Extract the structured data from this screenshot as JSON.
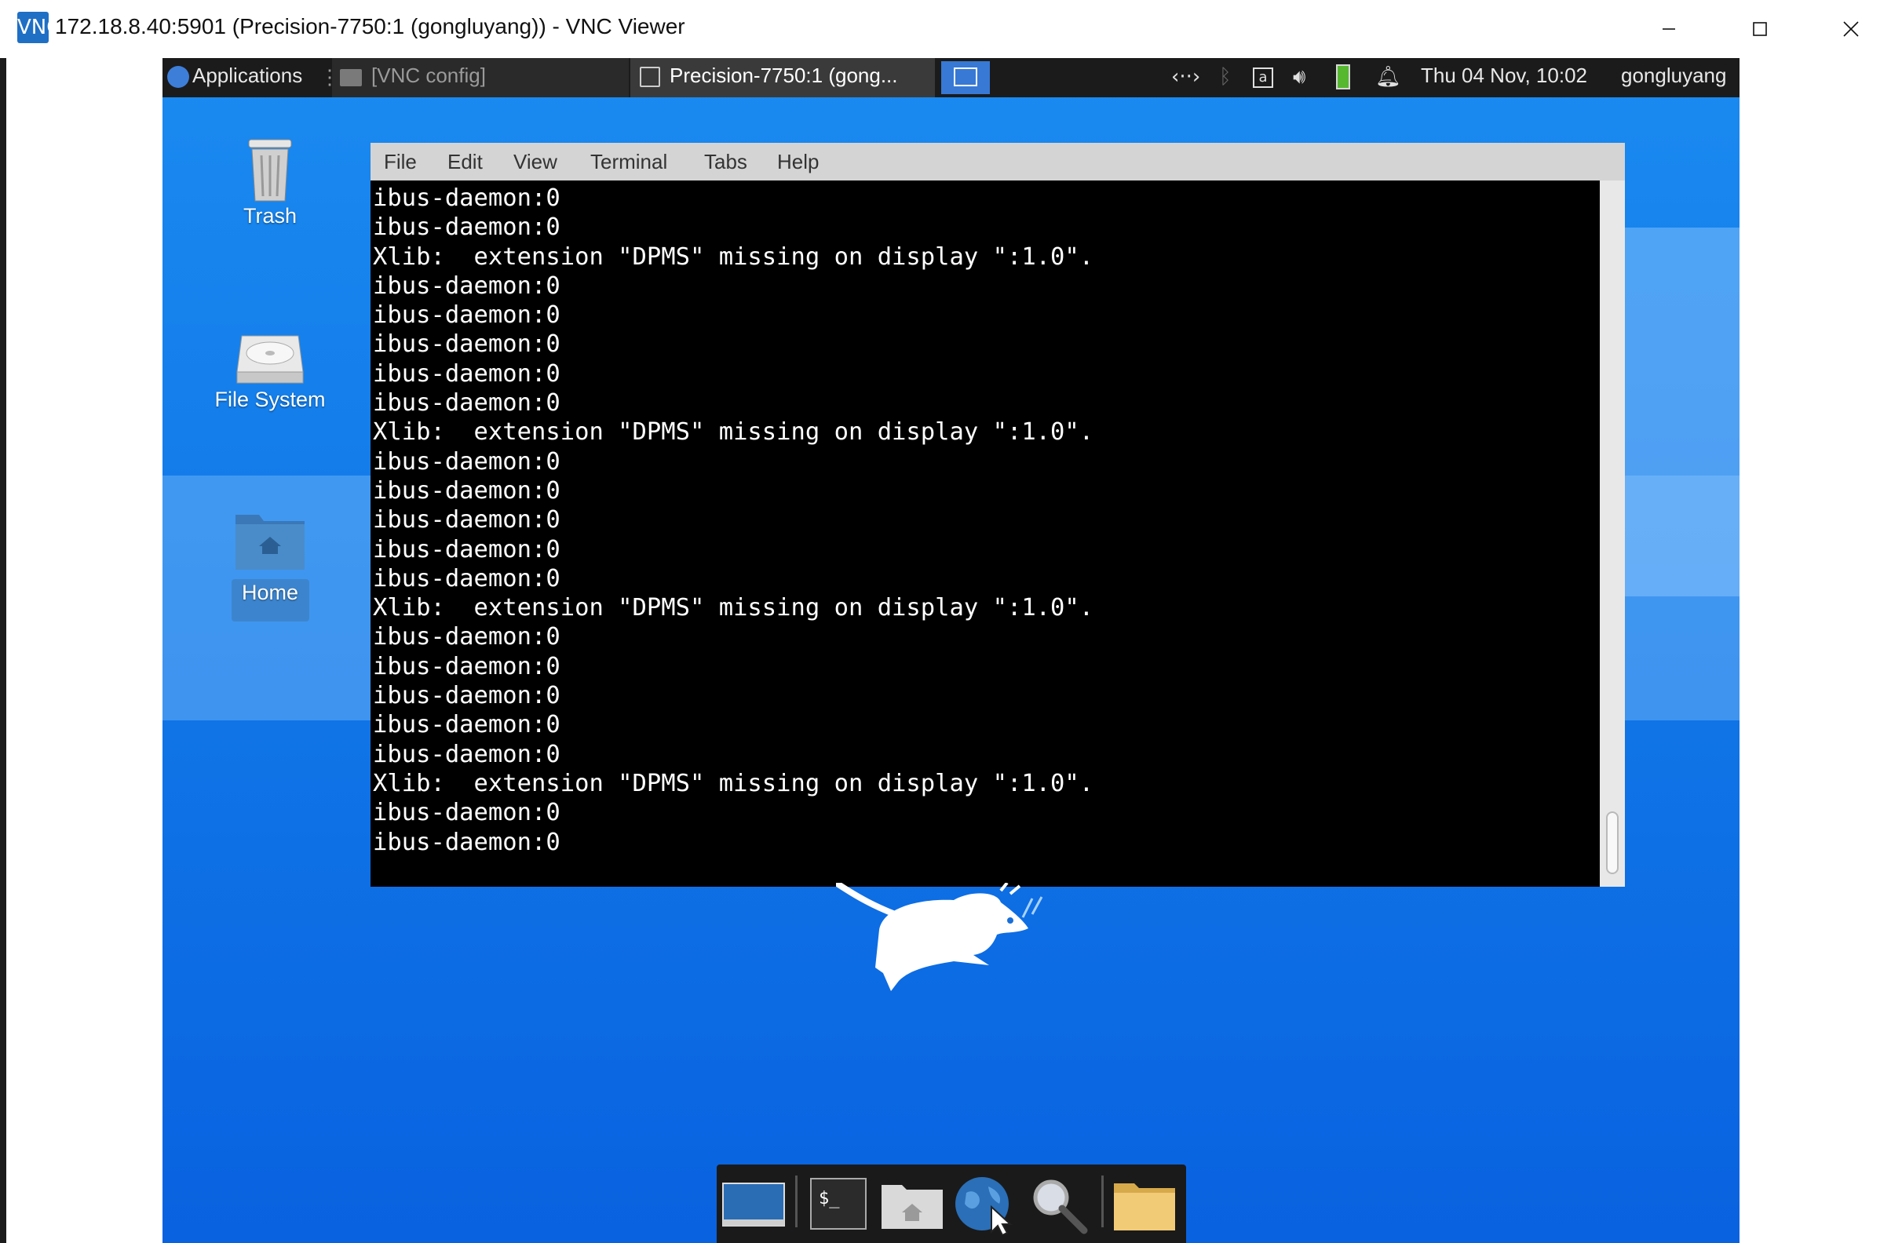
{
  "window": {
    "app_icon": "VNC",
    "title": "172.18.8.40:5901 (Precision-7750:1 (gongluyang)) - VNC Viewer",
    "controls": [
      "minimize-icon",
      "maximize-icon",
      "close-icon"
    ]
  },
  "panel": {
    "applications_label": "Applications",
    "tasks": [
      {
        "label": "[VNC config]",
        "active": false
      },
      {
        "label": "Precision-7750:1 (gong...",
        "active": true
      }
    ],
    "tray_icons": [
      "network-icon",
      "bluetooth-icon",
      "keyboard-layout-icon",
      "volume-icon",
      "battery-icon",
      "notification-bell-icon"
    ],
    "keyboard_letter": "a",
    "clock": "Thu 04 Nov, 10:02",
    "user": "gongluyang"
  },
  "desktop": {
    "icons": [
      {
        "label": "Trash",
        "icon": "trash-icon"
      },
      {
        "label": "File System",
        "icon": "drive-icon"
      },
      {
        "label": "Home",
        "icon": "home-folder-icon",
        "selected": true
      }
    ]
  },
  "terminal": {
    "menu": [
      "File",
      "Edit",
      "View",
      "Terminal",
      "Tabs",
      "Help"
    ],
    "lines": [
      "ibus-daemon:0",
      "ibus-daemon:0",
      "Xlib:  extension \"DPMS\" missing on display \":1.0\".",
      "ibus-daemon:0",
      "ibus-daemon:0",
      "ibus-daemon:0",
      "ibus-daemon:0",
      "ibus-daemon:0",
      "Xlib:  extension \"DPMS\" missing on display \":1.0\".",
      "ibus-daemon:0",
      "ibus-daemon:0",
      "ibus-daemon:0",
      "ibus-daemon:0",
      "ibus-daemon:0",
      "Xlib:  extension \"DPMS\" missing on display \":1.0\".",
      "ibus-daemon:0",
      "ibus-daemon:0",
      "ibus-daemon:0",
      "ibus-daemon:0",
      "ibus-daemon:0",
      "Xlib:  extension \"DPMS\" missing on display \":1.0\".",
      "ibus-daemon:0",
      "ibus-daemon:0"
    ]
  },
  "dock": {
    "items": [
      "show-desktop-icon",
      "terminal-icon",
      "home-folder-icon",
      "web-browser-icon",
      "search-icon",
      "folder-icon"
    ]
  },
  "colors": {
    "desktop_blue": "#0f73e6",
    "panel_bg": "#1b1b1b",
    "terminal_bg": "#000000",
    "terminal_menubar": "#d4d4d4"
  }
}
